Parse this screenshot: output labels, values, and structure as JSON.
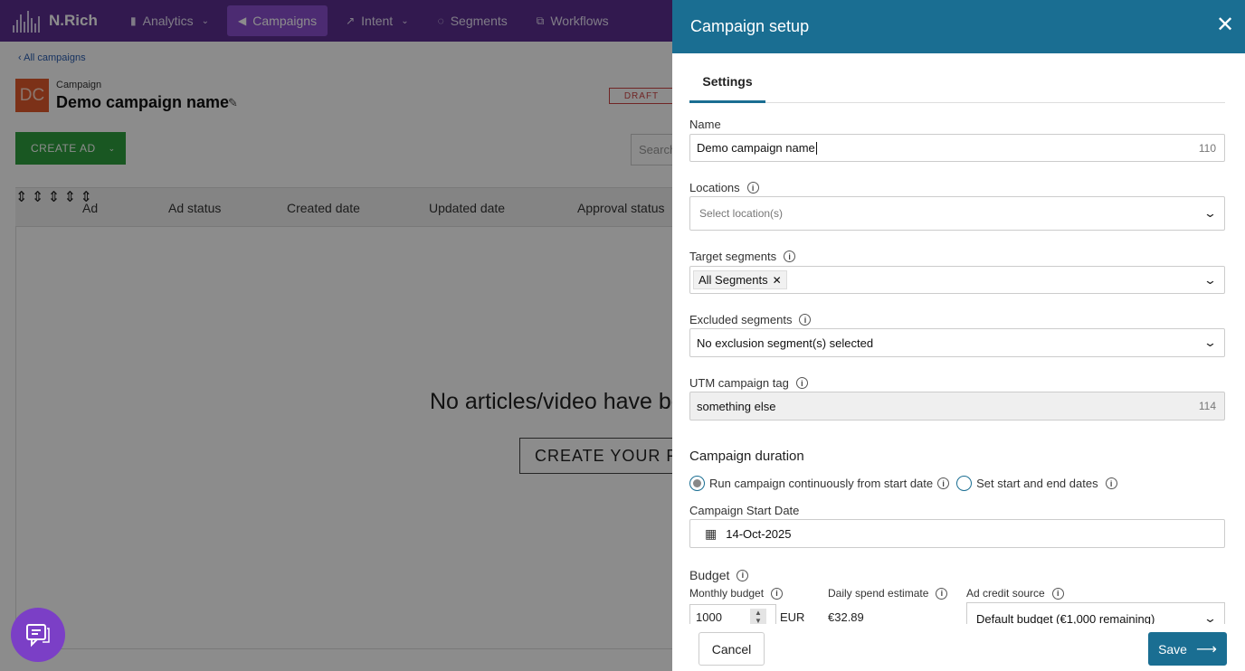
{
  "app": {
    "brand": "N.Rich",
    "nav": [
      {
        "label": "Analytics",
        "icon": "bar-chart-icon",
        "has_chevron": true
      },
      {
        "label": "Campaigns",
        "icon": "megaphone-icon",
        "active": true
      },
      {
        "label": "Intent",
        "icon": "trend-icon",
        "has_chevron": true
      },
      {
        "label": "Segments",
        "icon": "segments-icon"
      },
      {
        "label": "Workflows",
        "icon": "workflow-icon"
      }
    ],
    "breadcrumb": "All campaigns",
    "avatar_initials": "DC",
    "campaign_label": "Campaign",
    "campaign_name": "Demo campaign name",
    "status_badge": "DRAFT",
    "create_ad_label": "CREATE AD",
    "search_placeholder": "Search",
    "table_headers": [
      "Ad",
      "Ad status",
      "Created date",
      "Updated date",
      "Approval status"
    ],
    "empty_message": "No articles/video have be",
    "empty_button": "CREATE YOUR FIRST"
  },
  "drawer": {
    "title": "Campaign setup",
    "tab": "Settings",
    "name": {
      "label": "Name",
      "value": "Demo campaign name",
      "counter": "110"
    },
    "locations": {
      "label": "Locations",
      "placeholder": "Select location(s)"
    },
    "target_segments": {
      "label": "Target segments",
      "chip": "All Segments"
    },
    "excluded_segments": {
      "label": "Excluded segments",
      "value": "No exclusion segment(s) selected"
    },
    "utm": {
      "label": "UTM campaign tag",
      "value": "something else",
      "counter": "114"
    },
    "duration": {
      "title": "Campaign duration",
      "option_continuous": "Run campaign continuously from start date",
      "option_range": "Set start and end dates",
      "selected": "continuous"
    },
    "start_date": {
      "label": "Campaign Start Date",
      "value": "14-Oct-2025"
    },
    "budget": {
      "label": "Budget",
      "monthly_label": "Monthly budget",
      "monthly_value": "1000",
      "currency": "EUR",
      "daily_label": "Daily spend estimate",
      "daily_value": "€32.89",
      "credit_label": "Ad credit source",
      "credit_value": "Default budget (€1,000 remaining)"
    },
    "cancel_label": "Cancel",
    "save_label": "Save"
  },
  "colors": {
    "nav_bg": "#5b2f91",
    "nav_active": "#8a4fd0",
    "drawer_header": "#1a6e92",
    "create_ad_green": "#2e9e3e",
    "draft_red": "#cc4444"
  }
}
